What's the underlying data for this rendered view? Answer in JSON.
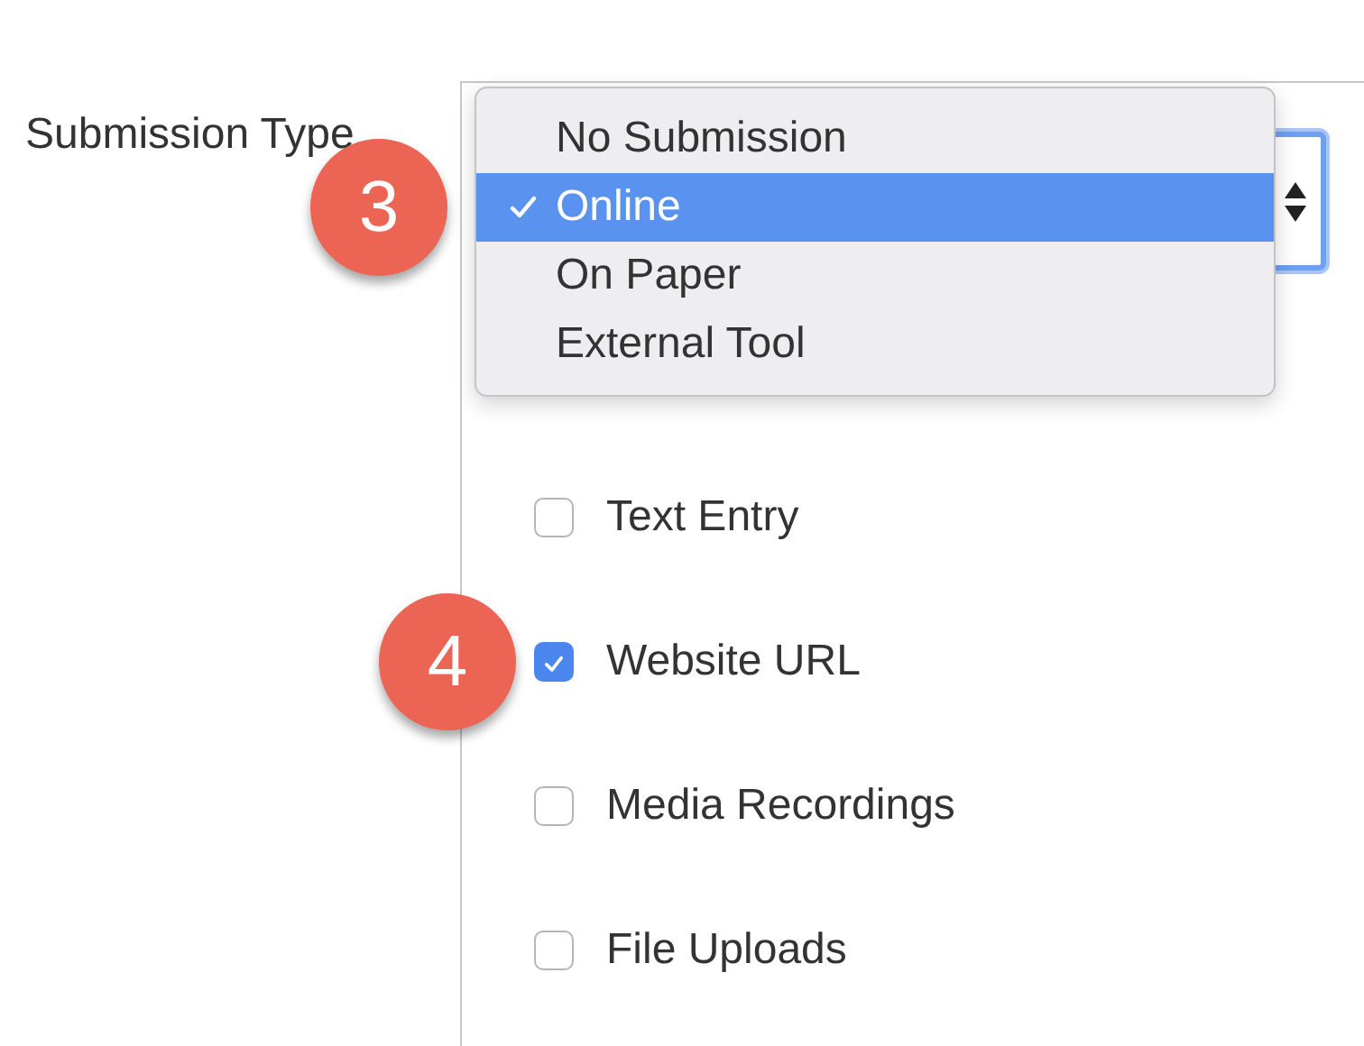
{
  "form_label": "Submission Type",
  "entry_options": [
    {
      "label": "Text Entry",
      "checked": false
    },
    {
      "label": "Website URL",
      "checked": true
    },
    {
      "label": "Media Recordings",
      "checked": false
    },
    {
      "label": "File Uploads",
      "checked": false
    }
  ],
  "dropdown_menu": {
    "options": [
      {
        "label": "No Submission",
        "selected": false
      },
      {
        "label": "Online",
        "selected": true
      },
      {
        "label": "On Paper",
        "selected": false
      },
      {
        "label": "External Tool",
        "selected": false
      }
    ]
  },
  "step_badges": [
    {
      "number": "3"
    },
    {
      "number": "4"
    }
  ]
}
